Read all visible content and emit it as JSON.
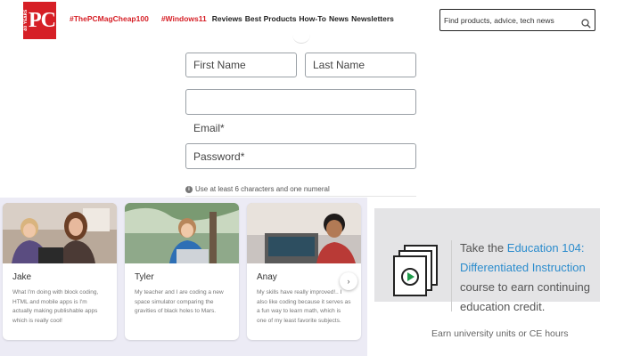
{
  "header": {
    "logo": {
      "years_text": "40 YEARS",
      "letters": "PC"
    },
    "trending": [
      "#ThePCMagCheap100",
      "#Windows11"
    ],
    "nav_links": [
      "Reviews",
      "Best Products",
      "How-To",
      "News",
      "Newsletters"
    ],
    "search": {
      "placeholder": "Find products, advice, tech news",
      "icon": "search-icon"
    }
  },
  "form": {
    "first_name": {
      "placeholder": "First Name",
      "value": ""
    },
    "last_name": {
      "placeholder": "Last Name",
      "value": ""
    },
    "email": {
      "value": "",
      "label": "Email*"
    },
    "password": {
      "placeholder": "Password*",
      "value": ""
    },
    "hint": "Use at least 6 characters and one numeral"
  },
  "cards": [
    {
      "name": "Jake",
      "quote": "What I'm doing with block coding, HTML and mobile apps is I'm actually making publishable apps which is really cool!"
    },
    {
      "name": "Tyler",
      "quote": "My teacher and I are coding a new space simulator comparing the gravities of black holes to Mars."
    },
    {
      "name": "Anay",
      "quote": "My skills have really improved!.. I also like coding because it serves as a fun way to learn math, which is one of my least favorite subjects."
    }
  ],
  "next_button": "›",
  "ad": {
    "text_before": "Take the",
    "course": "Education 104: Differentiated Instruction",
    "text_after": "course to earn continuing education credit.",
    "earn_text": "Earn university units or CE hours"
  },
  "colors": {
    "brand_red": "#d61f26",
    "accent_blue": "#2b8ccd",
    "cards_bg": "#ecebf5",
    "ad_bg": "#e4e4e6"
  }
}
